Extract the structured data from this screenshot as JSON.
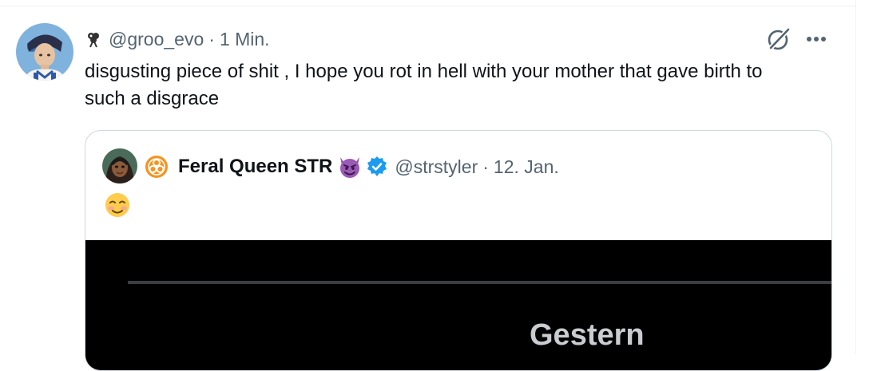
{
  "post": {
    "handle": "@groo_evo",
    "separator": "·",
    "time": "1 Min.",
    "text": "disgusting piece of shit , I hope you rot in hell with your mother that gave birth to such a disgrace"
  },
  "quoted_post": {
    "display_name": "Feral Queen STR",
    "handle": "@strstyler",
    "separator": "·",
    "time": "12. Jan.",
    "text_emoji": "smiling-face-with-blush",
    "name_emoji": "smiling-devil",
    "media": {
      "label": "Gestern"
    }
  },
  "icons": {
    "author_badge": "club-flower-icon",
    "grok": "grok-icon",
    "more": "more-horizontal-icon",
    "quoted_badge": "biohazard-icon",
    "verified": "verified-badge-icon"
  },
  "colors": {
    "text_primary": "#0f1419",
    "text_secondary": "#536471",
    "border": "#cfd9de",
    "verified_blue": "#1d9bf0",
    "biohazard_orange": "#f7931e",
    "devil_purple": "#9b59b6"
  }
}
